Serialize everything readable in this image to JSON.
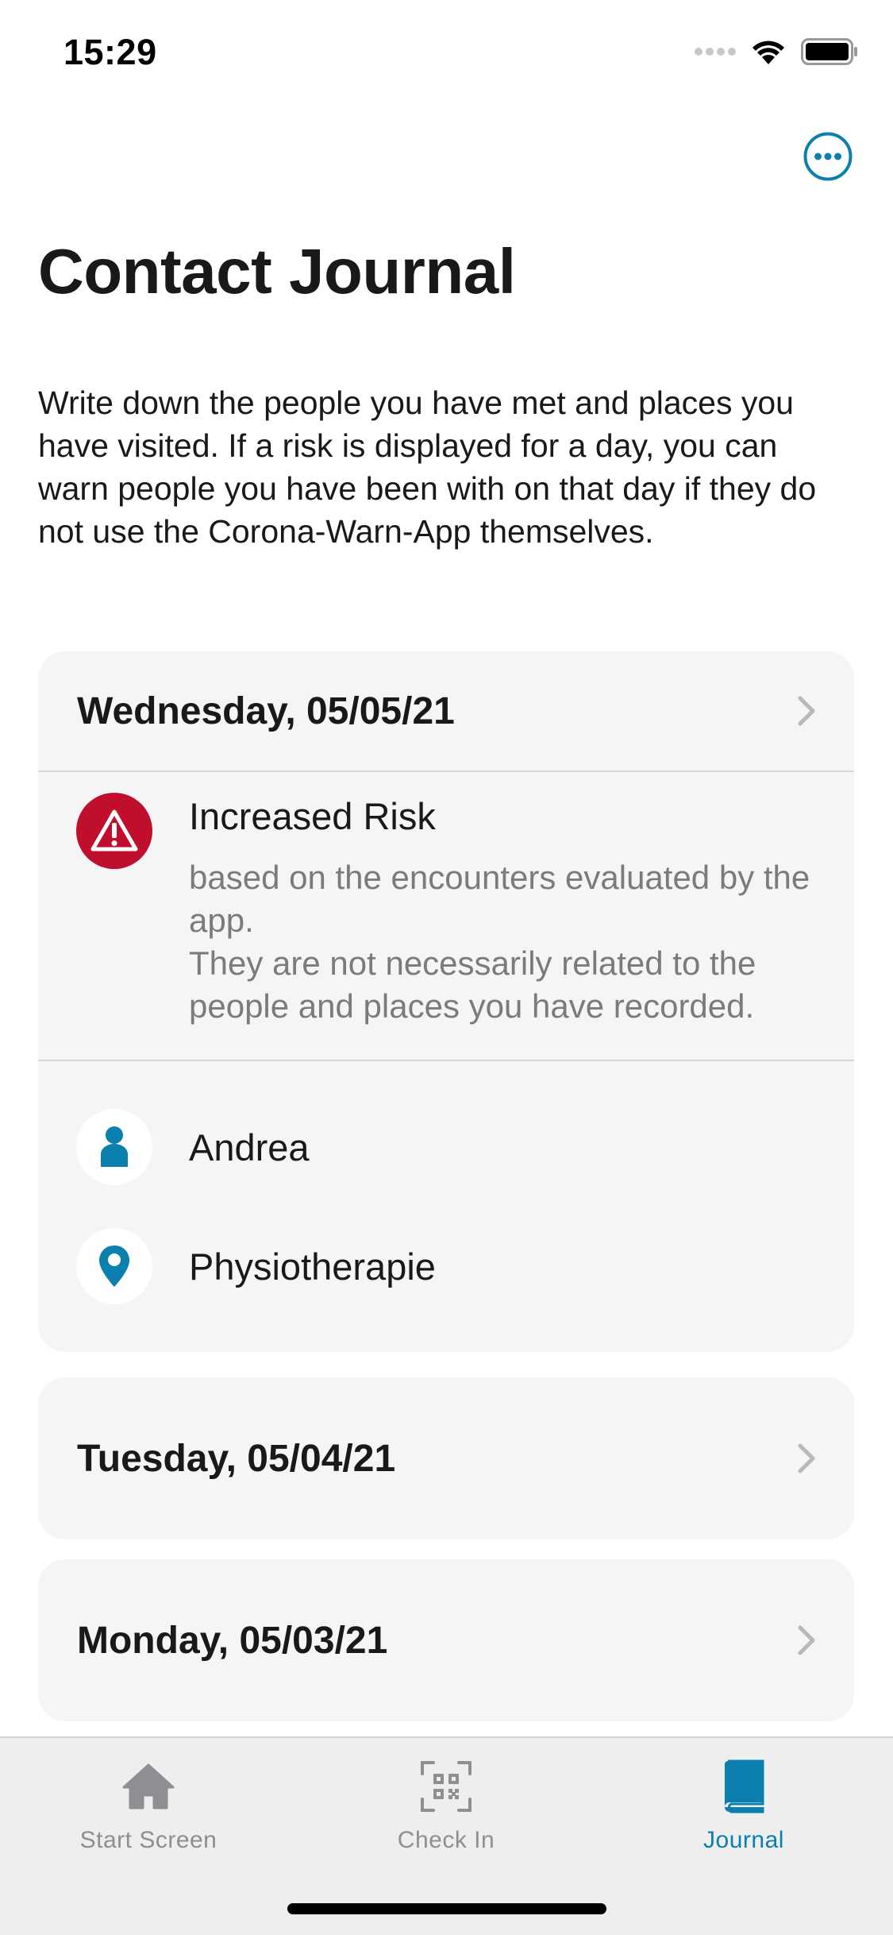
{
  "status_bar": {
    "time": "15:29"
  },
  "header": {
    "more_button_label": "More",
    "title": "Contact Journal",
    "description": "Write down the people you have met and places you have visited. If a risk is displayed for a day, you can warn people you have been with on that day if they do not use the Corona-Warn-App themselves."
  },
  "days": [
    {
      "date": "Wednesday, 05/05/21",
      "risk": {
        "title": "Increased Risk",
        "description": "based on the encounters evaluated by the app.\nThey are not necessarily related to the people and places you have recorded."
      },
      "entries": [
        {
          "type": "person",
          "icon": "person-icon",
          "label": "Andrea"
        },
        {
          "type": "location",
          "icon": "location-pin-icon",
          "label": "Physiotherapie"
        }
      ]
    },
    {
      "date": "Tuesday, 05/04/21"
    },
    {
      "date": "Monday, 05/03/21"
    }
  ],
  "tab_bar": {
    "tabs": [
      {
        "label": "Start Screen",
        "icon": "home-icon",
        "active": false
      },
      {
        "label": "Check In",
        "icon": "qr-code-icon",
        "active": false
      },
      {
        "label": "Journal",
        "icon": "book-icon",
        "active": true
      }
    ]
  },
  "colors": {
    "accent": "#0b7fad",
    "risk_red": "#c00f2d",
    "card_background": "#f5f5f5",
    "secondary_text": "#7b7b7d",
    "inactive_tab": "#8e8e93"
  }
}
